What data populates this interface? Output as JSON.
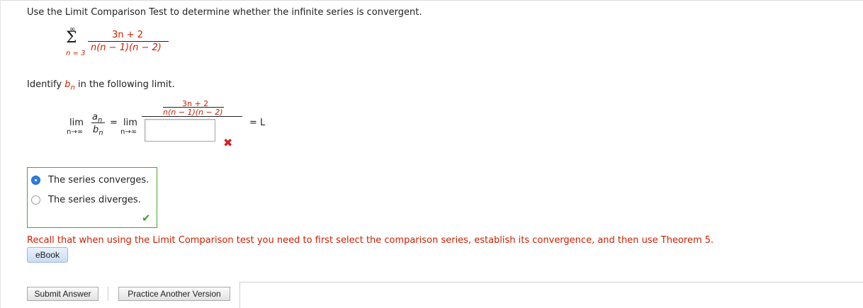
{
  "question": {
    "prompt": "Use the Limit Comparison Test to determine whether the infinite series is convergent.",
    "series": {
      "sum_upper": "∞",
      "sum_lower": "n = 3",
      "numerator": "3n + 2",
      "denominator": "n(n − 1)(n − 2)"
    }
  },
  "part1": {
    "label_prefix": "Identify",
    "label_var": "b",
    "label_sub": "n",
    "label_suffix": "in the following limit.",
    "lim_word": "lim",
    "lim_under": "n→∞",
    "a_var": "a",
    "a_sub": "n",
    "b_var": "b",
    "b_sub": "n",
    "equals": "=",
    "inner_numerator": "3n + 2",
    "inner_denominator": "n(n − 1)(n − 2)",
    "answer_value": "",
    "result": "= L",
    "status": "incorrect"
  },
  "choices": {
    "selected_index": 0,
    "options": [
      {
        "label": "The series converges."
      },
      {
        "label": "The series diverges."
      }
    ],
    "status": "correct"
  },
  "feedback": "Recall that when using the Limit Comparison test you need to first select the comparison series, establish its convergence, and then use Theorem 5.",
  "buttons": {
    "ebook": "eBook",
    "submit": "Submit Answer",
    "practice": "Practice Another Version"
  },
  "colors": {
    "accent_red": "#cc1f00",
    "correct_green": "#4aa531",
    "radio_blue": "#2b7de1"
  }
}
